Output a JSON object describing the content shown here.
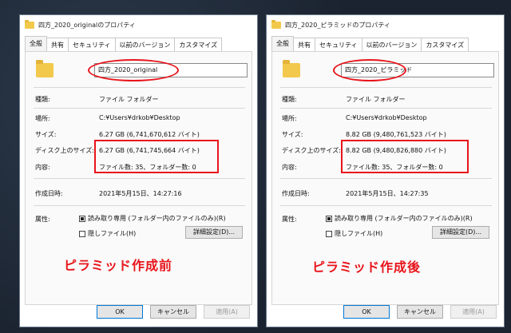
{
  "dialogs": [
    {
      "title": "四方_2020_originalのプロパティ",
      "tabs": [
        "全般",
        "共有",
        "セキュリティ",
        "以前のバージョン",
        "カスタマイズ"
      ],
      "active_tab": "全般",
      "folder_name": "四方_2020_original",
      "rows": {
        "type_label": "種類:",
        "type_value": "ファイル フォルダー",
        "location_label": "場所:",
        "location_value": "C:¥Users¥drkob¥Desktop",
        "size_label": "サイズ:",
        "size_value": "6.27 GB (6,741,670,612 バイト)",
        "disk_size_label": "ディスク上のサイズ:",
        "disk_size_value": "6.27 GB (6,741,745,664 バイト)",
        "contents_label": "内容:",
        "contents_value": "ファイル数: 35、フォルダー数: 0",
        "created_label": "作成日時:",
        "created_value": "2021年5月15日、14:27:16",
        "attributes_label": "属性:",
        "readonly_label": "読み取り専用 (フォルダー内のファイルのみ)(R)",
        "hidden_label": "隠しファイル(H)",
        "advanced_label": "詳細設定(D)..."
      },
      "buttons": {
        "ok": "OK",
        "cancel": "キャンセル",
        "apply": "適用(A)"
      },
      "caption": "ピラミッド作成前"
    },
    {
      "title": "四方_2020_ピラミッドのプロパティ",
      "tabs": [
        "全般",
        "共有",
        "セキュリティ",
        "以前のバージョン",
        "カスタマイズ"
      ],
      "active_tab": "全般",
      "folder_name": "四方_2020_ピラミッド",
      "rows": {
        "type_label": "種類:",
        "type_value": "ファイル フォルダー",
        "location_label": "場所:",
        "location_value": "C:¥Users¥drkob¥Desktop",
        "size_label": "サイズ:",
        "size_value": "8.82 GB (9,480,761,523 バイト)",
        "disk_size_label": "ディスク上のサイズ:",
        "disk_size_value": "8.82 GB (9,480,826,880 バイト)",
        "contents_label": "内容:",
        "contents_value": "ファイル数: 35、フォルダー数: 0",
        "created_label": "作成日時:",
        "created_value": "2021年5月15日、14:27:35",
        "attributes_label": "属性:",
        "readonly_label": "読み取り専用 (フォルダー内のファイルのみ)(R)",
        "hidden_label": "隠しファイル(H)",
        "advanced_label": "詳細設定(D)..."
      },
      "buttons": {
        "ok": "OK",
        "cancel": "キャンセル",
        "apply": "適用(A)"
      },
      "caption": "ピラミッド作成後"
    }
  ],
  "colors": {
    "annotation_red": "#e8141b",
    "folder_yellow": "#f2c94c"
  }
}
